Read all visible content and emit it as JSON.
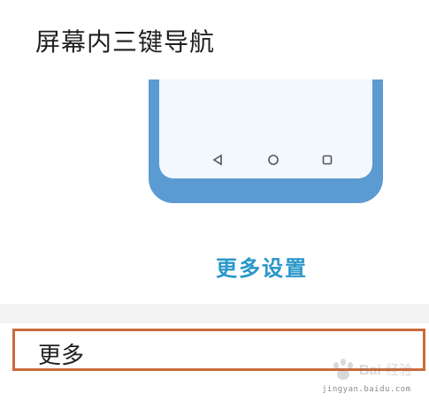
{
  "navigation_section": {
    "title": "屏幕内三键导航",
    "preview_nav_icons": [
      "back-triangle-icon",
      "home-circle-icon",
      "recent-square-icon"
    ],
    "more_settings_label": "更多设置"
  },
  "more_row": {
    "label": "更多"
  },
  "watermark": {
    "text": "Baidu经验",
    "url": "jingyan.baidu.com"
  },
  "colors": {
    "accent_link": "#2a97c9",
    "phone_frame": "#5b9bd1",
    "highlight_border": "#cc6a3d"
  }
}
